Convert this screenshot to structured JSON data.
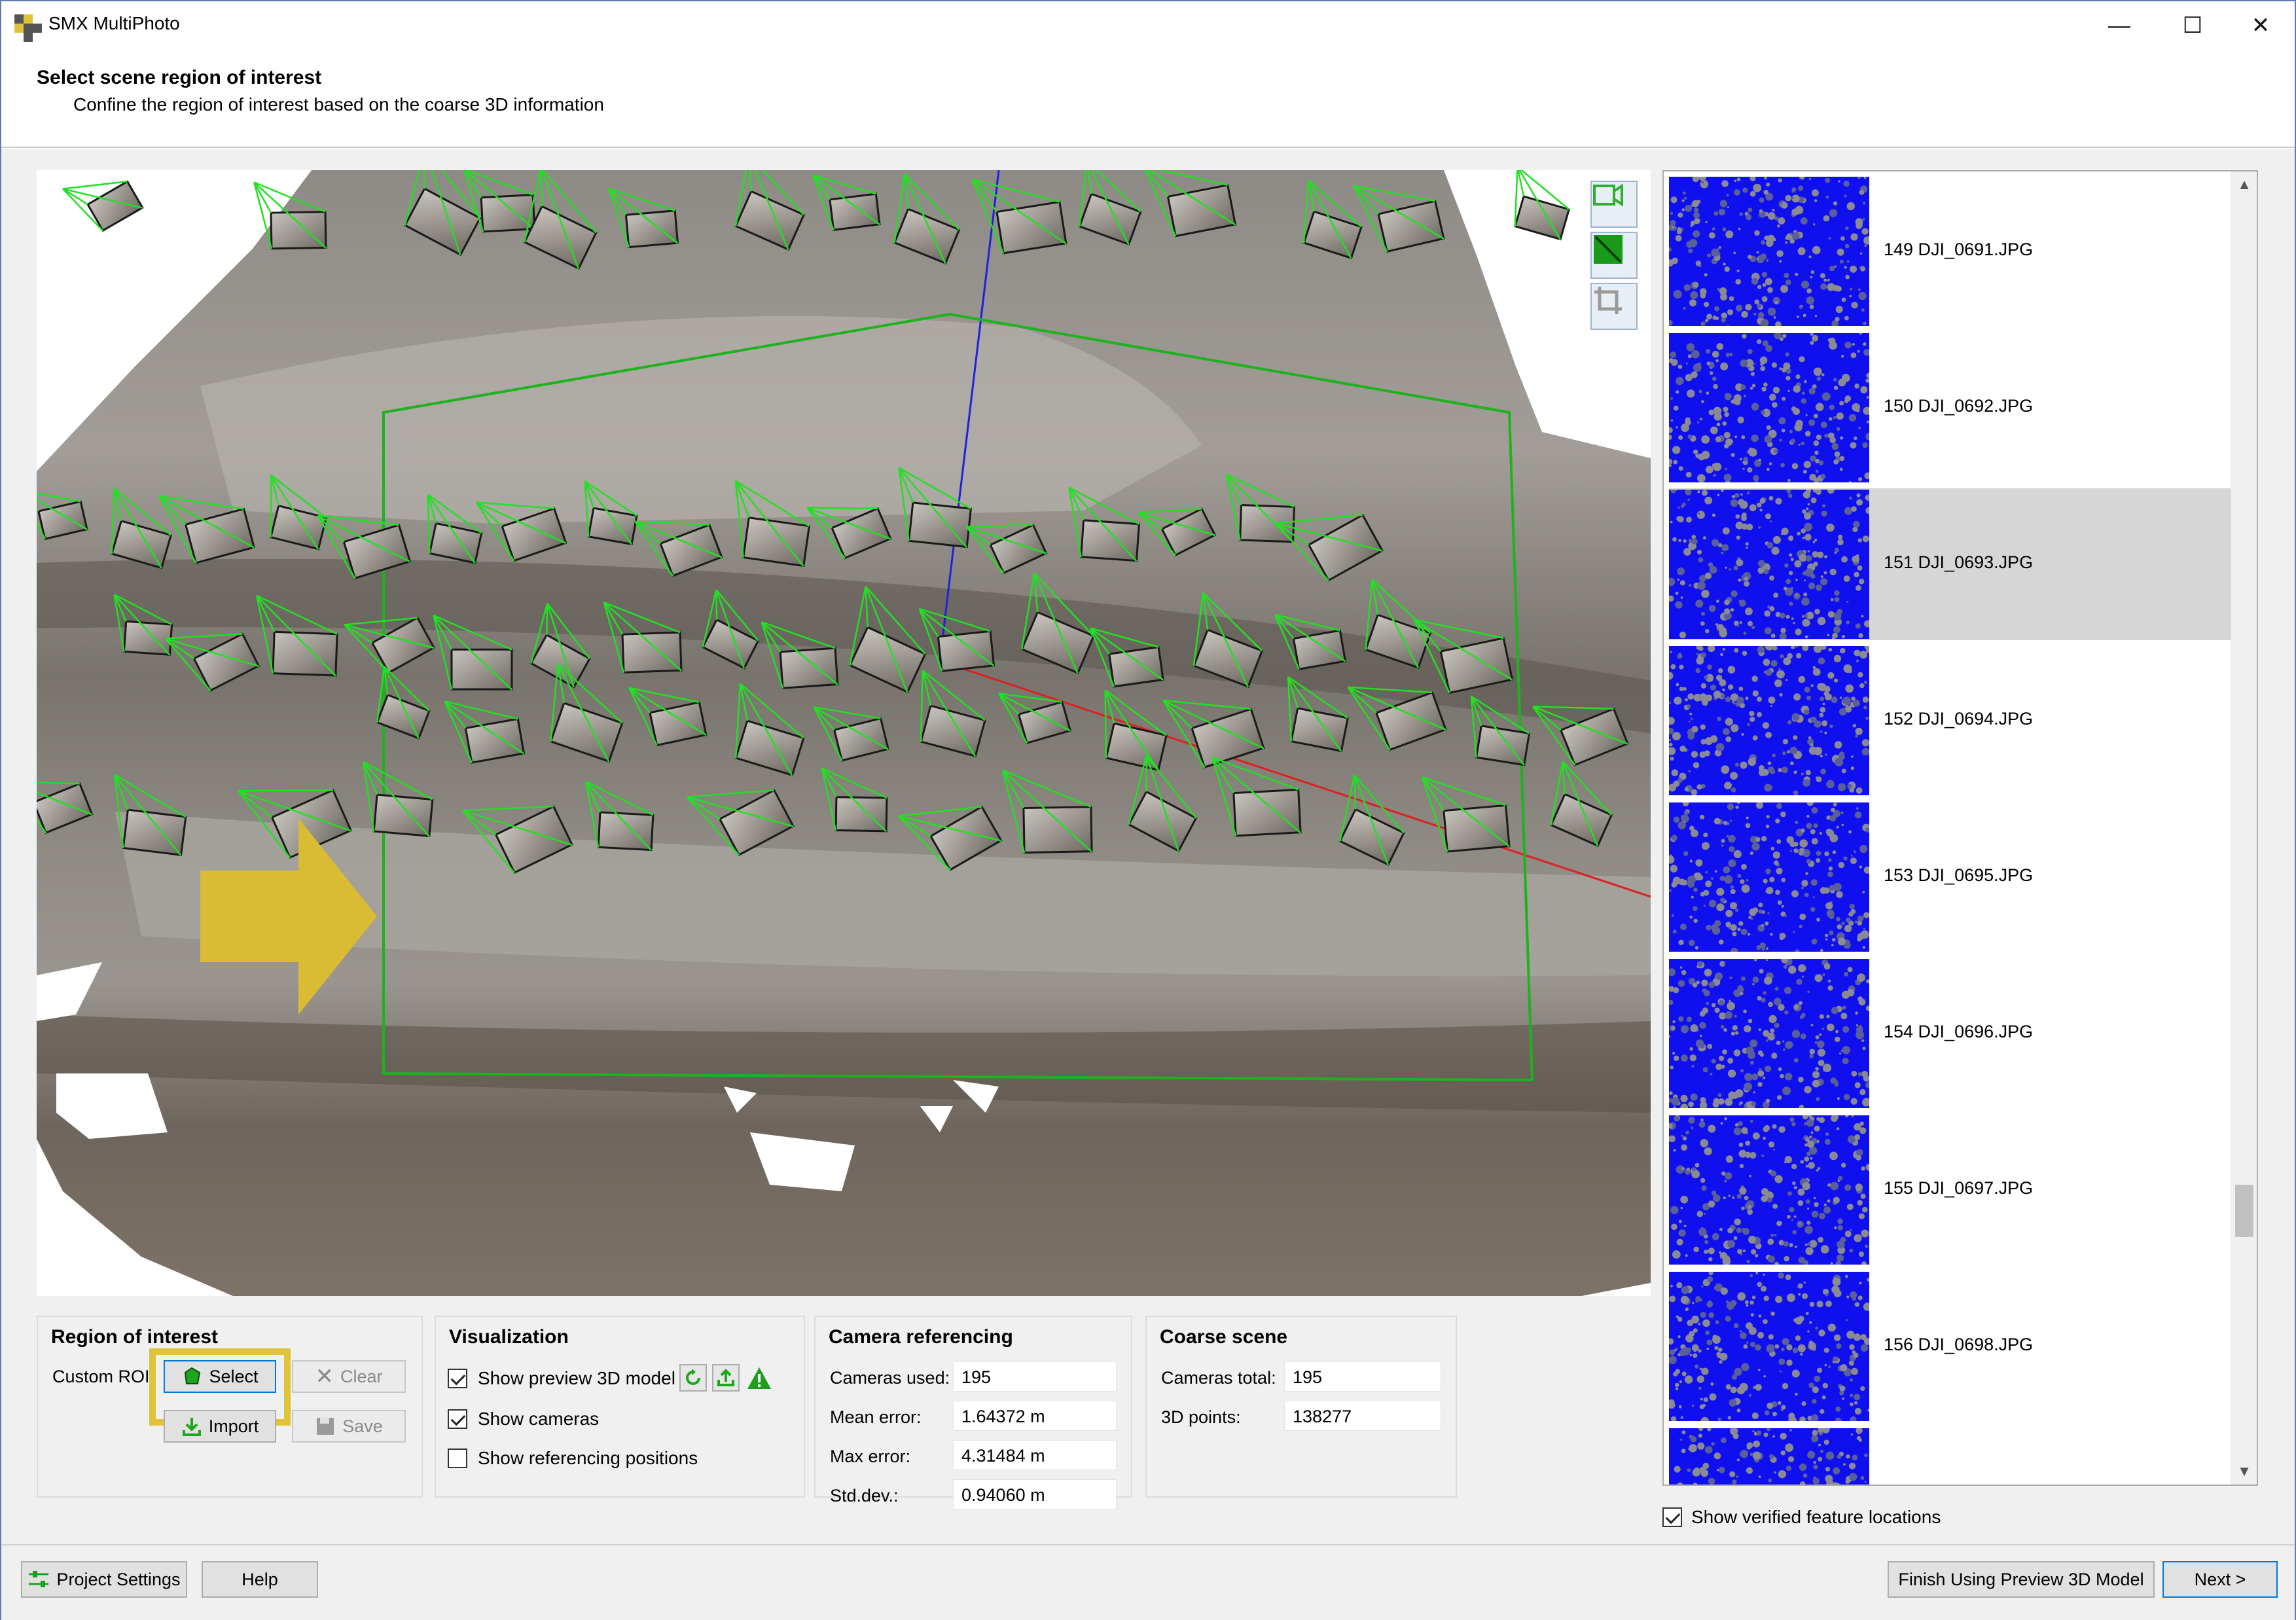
{
  "window": {
    "title": "SMX MultiPhoto",
    "controls": {
      "minimize": "—",
      "maximize": "☐",
      "close": "✕"
    }
  },
  "header": {
    "title": "Select scene region of interest",
    "subtitle": "Confine the region of interest based on the coarse 3D information"
  },
  "viewer": {
    "tools": [
      {
        "name": "camera-view-icon"
      },
      {
        "name": "region-polygon-icon"
      },
      {
        "name": "crop-frame-icon"
      }
    ],
    "colors": {
      "roi": "#1db31d",
      "camera": "#22e022",
      "axis_blue": "#2020dd",
      "axis_red": "#dd2020",
      "arrow": "#d9bb34"
    }
  },
  "thumbnails": {
    "items": [
      {
        "label": "149 DJI_0691.JPG",
        "selected": false
      },
      {
        "label": "150 DJI_0692.JPG",
        "selected": false
      },
      {
        "label": "151 DJI_0693.JPG",
        "selected": true
      },
      {
        "label": "152 DJI_0694.JPG",
        "selected": false
      },
      {
        "label": "153 DJI_0695.JPG",
        "selected": false
      },
      {
        "label": "154 DJI_0696.JPG",
        "selected": false
      },
      {
        "label": "155 DJI_0697.JPG",
        "selected": false
      },
      {
        "label": "156 DJI_0698.JPG",
        "selected": false
      },
      {
        "label": "",
        "selected": false
      }
    ],
    "show_verified_label": "Show verified feature locations",
    "show_verified_checked": true
  },
  "roi": {
    "title": "Region of interest",
    "custom_label": "Custom ROI",
    "select": "Select",
    "clear": "Clear",
    "import": "Import",
    "save": "Save"
  },
  "visualization": {
    "title": "Visualization",
    "show_preview": "Show preview 3D model",
    "show_cameras": "Show cameras",
    "show_referencing": "Show referencing positions",
    "show_preview_checked": true,
    "show_cameras_checked": true,
    "show_referencing_checked": false
  },
  "camera_referencing": {
    "title": "Camera referencing",
    "rows": [
      {
        "label": "Cameras used:",
        "value": "195"
      },
      {
        "label": "Mean error:",
        "value": "1.64372 m"
      },
      {
        "label": "Max error:",
        "value": "4.31484 m"
      },
      {
        "label": "Std.dev.:",
        "value": "0.94060 m"
      }
    ]
  },
  "coarse_scene": {
    "title": "Coarse scene",
    "rows": [
      {
        "label": "Cameras total:",
        "value": "195"
      },
      {
        "label": "3D points:",
        "value": "138277"
      }
    ]
  },
  "bottom": {
    "project_settings": "Project Settings",
    "help": "Help",
    "finish": "Finish Using Preview 3D Model",
    "next": "Next >"
  }
}
